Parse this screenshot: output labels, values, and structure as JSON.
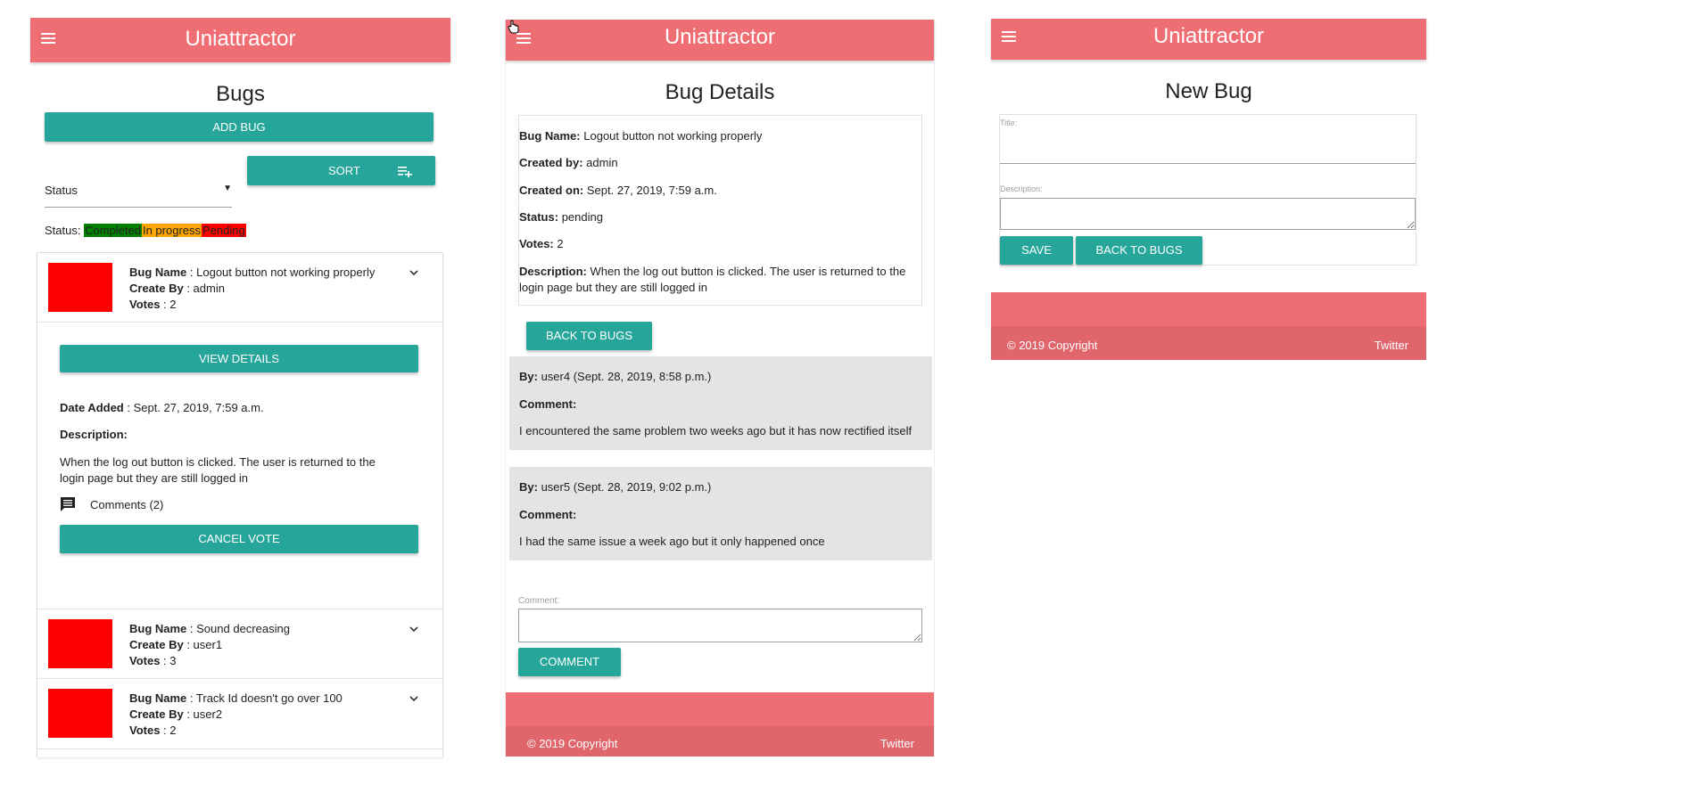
{
  "app": {
    "brand": "Uniattractor"
  },
  "screen1": {
    "title": "Bugs",
    "add_button": "ADD BUG",
    "sort_select": "Status",
    "sort_button": "SORT",
    "legend": {
      "prefix": "Status:",
      "completed": "Completed",
      "in_progress": "In progress",
      "pending": "Pending",
      "colors": {
        "completed": "#008000",
        "in_progress": "#ffa500",
        "pending": "#ff0000"
      }
    },
    "labels": {
      "bug_name": "Bug Name",
      "created_by": "Create By",
      "votes": "Votes",
      "date_added": "Date Added",
      "description": "Description:"
    },
    "bugs": [
      {
        "name": "Logout button not working properly",
        "created_by": "admin",
        "votes": "2"
      },
      {
        "name": "Sound decreasing",
        "created_by": "user1",
        "votes": "3"
      },
      {
        "name": "Track Id doesn't go over 100",
        "created_by": "user2",
        "votes": "2"
      }
    ],
    "expanded": {
      "view_button": "VIEW DETAILS",
      "date_added": "Sept. 27, 2019, 7:59 a.m.",
      "description": "When the log out button is clicked. The user is returned to the login page but they are still logged in",
      "comments": "Comments (2)",
      "cancel_button": "CANCEL VOTE"
    }
  },
  "screen2": {
    "title": "Bug Details",
    "details": {
      "name_label": "Bug Name:",
      "name": "Logout button not working properly",
      "created_by_label": "Created by:",
      "created_by": "admin",
      "created_on_label": "Created on:",
      "created_on": "Sept. 27, 2019, 7:59 a.m.",
      "status_label": "Status:",
      "status": "pending",
      "votes_label": "Votes:",
      "votes": "2",
      "description_label": "Description:",
      "description": "When the log out button is clicked. The user is returned to the login page but they are still logged in"
    },
    "back_button": "BACK TO BUGS",
    "comments": [
      {
        "by_label": "By:",
        "by": "user4 (Sept. 28, 2019, 8:58 p.m.)",
        "comment_label": "Comment:",
        "text": "I encountered the same problem two weeks ago but it has now rectified itself"
      },
      {
        "by_label": "By:",
        "by": "user5 (Sept. 28, 2019, 9:02 p.m.)",
        "comment_label": "Comment:",
        "text": "I had the same issue a week ago but it only happened once"
      }
    ],
    "comment_field_label": "Comment:",
    "comment_button": "COMMENT",
    "footer": {
      "copyright": "© 2019 Copyright",
      "link": "Twitter"
    }
  },
  "screen3": {
    "title": "New Bug",
    "title_label": "Title:",
    "description_label": "Description:",
    "save_button": "SAVE",
    "back_button": "BACK TO BUGS",
    "footer": {
      "copyright": "© 2019 Copyright",
      "link": "Twitter"
    }
  }
}
